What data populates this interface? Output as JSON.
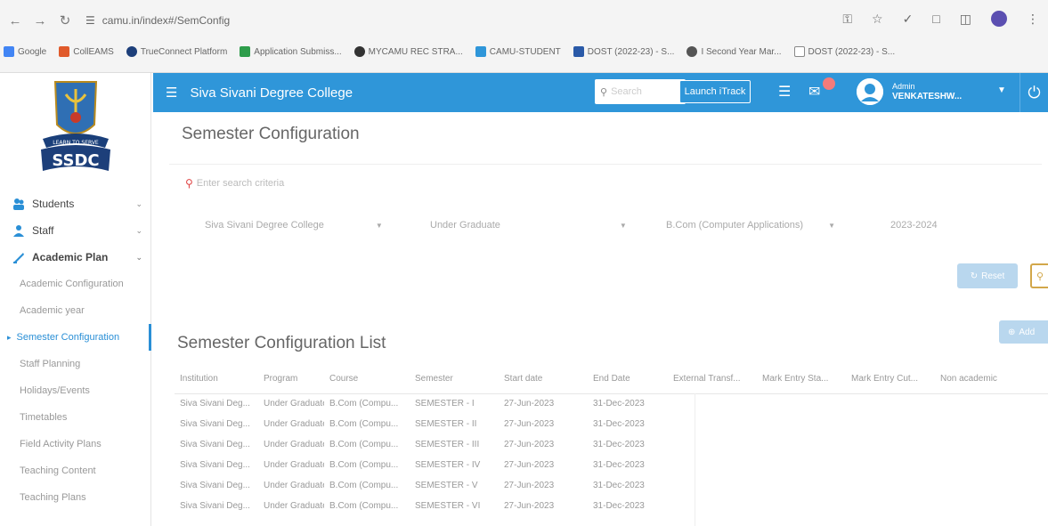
{
  "browser": {
    "url": "camu.in/index#/SemConfig",
    "bookmarks": [
      {
        "label": "Google",
        "color": "#4285f4"
      },
      {
        "label": "CollEAMS",
        "color": "#e05a2b"
      },
      {
        "label": "TrueConnect Platform",
        "color": "#1d3f7a"
      },
      {
        "label": "Application Submiss...",
        "color": "#2e9d4b"
      },
      {
        "label": "MYCAMU REC STRA...",
        "color": "#333333"
      },
      {
        "label": "CAMU-STUDENT",
        "color": "#2f96d9"
      },
      {
        "label": "DOST (2022-23) - S...",
        "color": "#2a5aa8"
      },
      {
        "label": "I Second Year Mar...",
        "color": "#555555"
      },
      {
        "label": "DOST (2022-23) - S...",
        "color": "#555555"
      }
    ]
  },
  "sidebar": {
    "logo_text": "SSDC",
    "logo_banner": "LEARN TO SERVE",
    "sections": [
      {
        "label": "Students",
        "color": "#2a8fd6"
      },
      {
        "label": "Staff",
        "color": "#2a8fd6"
      },
      {
        "label": "Academic Plan",
        "color": "#2a8fd6"
      }
    ],
    "sub_items": [
      "Academic Configuration",
      "Academic year",
      "Semester Configuration",
      "Staff Planning",
      "Holidays/Events",
      "Timetables",
      "Field Activity Plans",
      "Teaching Content",
      "Teaching Plans"
    ],
    "active_index": 2
  },
  "appbar": {
    "title": "Siva Sivani Degree College",
    "search_placeholder": "Search",
    "launch_label": "Launch iTrack",
    "user_role": "Admin",
    "user_name": "VENKATESHW..."
  },
  "page": {
    "title": "Semester Configuration",
    "search_criteria_placeholder": "Enter search criteria",
    "filters": {
      "institution": "Siva Sivani Degree College",
      "program": "Under Graduate",
      "course": "B.Com (Computer Applications)",
      "year": "2023-2024"
    },
    "reset_label": "Reset",
    "add_label": "Add",
    "list_title": "Semester Configuration List"
  },
  "table": {
    "headers": [
      "Institution",
      "Program",
      "Course",
      "Semester",
      "Start date",
      "End Date",
      "External Transf...",
      "Mark Entry Sta...",
      "Mark Entry Cut...",
      "Non academic"
    ],
    "rows": [
      [
        "Siva Sivani Deg...",
        "Under Graduate",
        "B.Com (Compu...",
        "SEMESTER - I",
        "27-Jun-2023",
        "31-Dec-2023",
        "",
        "",
        "",
        ""
      ],
      [
        "Siva Sivani Deg...",
        "Under Graduate",
        "B.Com (Compu...",
        "SEMESTER - II",
        "27-Jun-2023",
        "31-Dec-2023",
        "",
        "",
        "",
        ""
      ],
      [
        "Siva Sivani Deg...",
        "Under Graduate",
        "B.Com (Compu...",
        "SEMESTER - III",
        "27-Jun-2023",
        "31-Dec-2023",
        "",
        "",
        "",
        ""
      ],
      [
        "Siva Sivani Deg...",
        "Under Graduate",
        "B.Com (Compu...",
        "SEMESTER - IV",
        "27-Jun-2023",
        "31-Dec-2023",
        "",
        "",
        "",
        ""
      ],
      [
        "Siva Sivani Deg...",
        "Under Graduate",
        "B.Com (Compu...",
        "SEMESTER - V",
        "27-Jun-2023",
        "31-Dec-2023",
        "",
        "",
        "",
        ""
      ],
      [
        "Siva Sivani Deg...",
        "Under Graduate",
        "B.Com (Compu...",
        "SEMESTER - VI",
        "27-Jun-2023",
        "31-Dec-2023",
        "",
        "",
        "",
        ""
      ]
    ]
  },
  "colors": {
    "primary": "#2f96d9",
    "badge": "#f47b7b",
    "reset_button": "#b9d7ee",
    "accent_gold": "#d2a74a"
  }
}
